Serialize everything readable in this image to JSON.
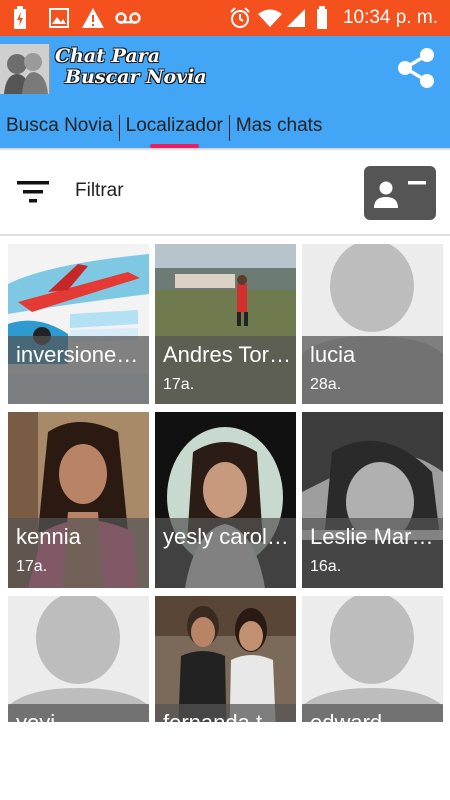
{
  "status_bar": {
    "time": "10:34 p. m.",
    "icons": [
      "battery-charging-icon",
      "image-icon",
      "warning-icon",
      "voicemail-icon",
      "alarm-icon",
      "wifi-icon",
      "signal-icon",
      "battery-icon"
    ]
  },
  "app_bar": {
    "title_line1": "Chat Para",
    "title_line2": "Buscar Novia",
    "share_icon": "share-icon"
  },
  "tabs": [
    {
      "label": "Busca Novia",
      "active": false
    },
    {
      "label": "Localizador",
      "active": true
    },
    {
      "label": "Mas chats",
      "active": false
    }
  ],
  "filter": {
    "label": "Filtrar"
  },
  "colors": {
    "status_bar": "#f4511e",
    "app_bar": "#42a5f5",
    "tab_indicator": "#e91e63"
  },
  "profiles": [
    {
      "name": "inversione…",
      "age": "",
      "photo": "airline-ad"
    },
    {
      "name": "Andres Tor…",
      "age": "17a.",
      "photo": "soccer-field"
    },
    {
      "name": "lucia",
      "age": "28a.",
      "photo": "placeholder-avatar"
    },
    {
      "name": "kennia",
      "age": "17a.",
      "photo": "selfie"
    },
    {
      "name": "yesly carol…",
      "age": "",
      "photo": "portrait-vignette"
    },
    {
      "name": "Leslie Mar…",
      "age": "16a.",
      "photo": "bw-portrait"
    },
    {
      "name": "yeyi",
      "age": "",
      "photo": "placeholder-avatar"
    },
    {
      "name": "fernanda t…",
      "age": "",
      "photo": "two-girls"
    },
    {
      "name": "edward",
      "age": "",
      "photo": "placeholder-avatar"
    }
  ]
}
